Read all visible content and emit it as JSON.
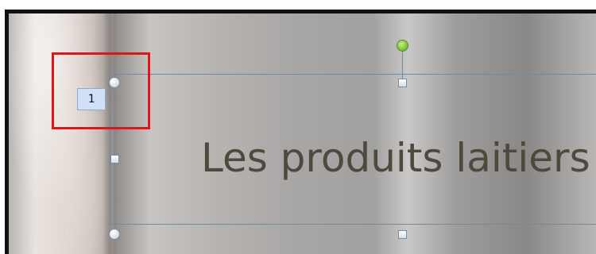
{
  "slide": {
    "title_text": "Les produits laitiers",
    "placeholder_tag": "1"
  },
  "colors": {
    "highlight": "#e1141a",
    "selection_border": "#6f8aa6",
    "rotation_handle": "#7cc43a",
    "tag_background": "#cfe0f7"
  },
  "icons": {
    "rotation": "rotation-handle-icon",
    "resize_corner": "resize-handle-corner-icon",
    "resize_side": "resize-handle-side-icon"
  }
}
